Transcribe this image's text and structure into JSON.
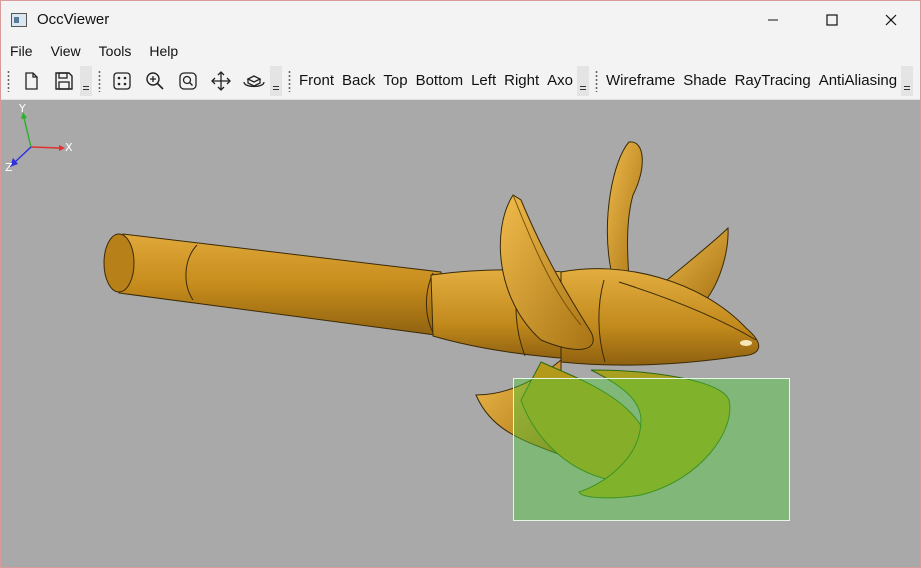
{
  "window": {
    "title": "OccViewer"
  },
  "menu": {
    "items": [
      "File",
      "View",
      "Tools",
      "Help"
    ]
  },
  "toolbar": {
    "file_icons": [
      "new-document-icon",
      "save-icon"
    ],
    "view_icons": [
      "fit-all-icon",
      "zoom-icon",
      "zoom-window-icon",
      "pan-icon",
      "rotate-icon"
    ],
    "views": [
      "Front",
      "Back",
      "Top",
      "Bottom",
      "Left",
      "Right",
      "Axo"
    ],
    "modes": [
      "Wireframe",
      "Shade",
      "RayTracing",
      "AntiAliasing"
    ]
  },
  "viewport": {
    "background": "#a9a9a9",
    "model_color": "#c9901c",
    "selection_color": "#50c83c",
    "triad": {
      "x_label": "X",
      "y_label": "Y",
      "z_label": "Z"
    }
  }
}
